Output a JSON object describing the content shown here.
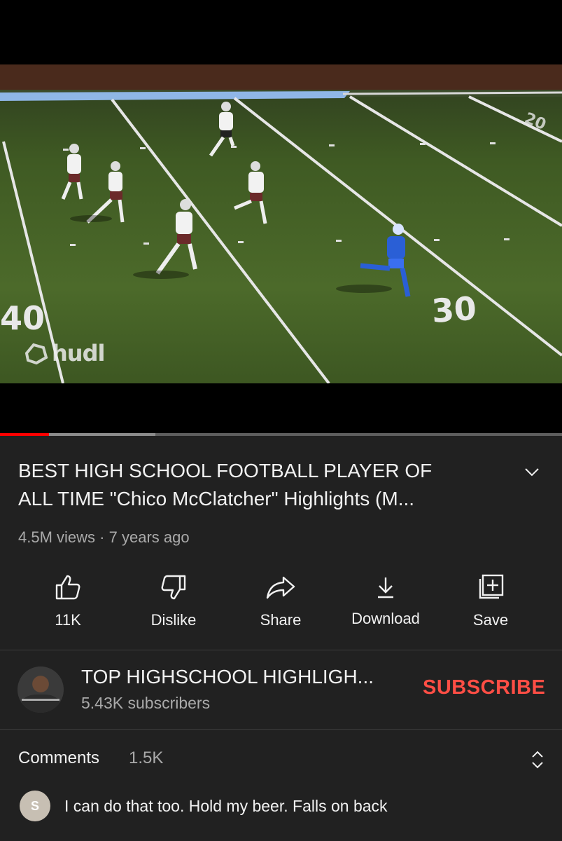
{
  "player": {
    "watermark": "hudl",
    "progress": {
      "played_fraction": 0.087,
      "buffered_fraction": 0.277
    },
    "field_numbers": [
      "40",
      "30",
      "20"
    ]
  },
  "video": {
    "title_line1": "BEST HIGH SCHOOL FOOTBALL PLAYER OF",
    "title_line2": "ALL TIME \"Chico McClatcher\" Highlights (M...",
    "views": "4.5M views",
    "separator": "·",
    "age": "7 years ago"
  },
  "actions": [
    {
      "label": "11K",
      "icon": "thumbs-up-icon"
    },
    {
      "label": "Dislike",
      "icon": "thumbs-down-icon"
    },
    {
      "label": "Share",
      "icon": "share-arrow-icon"
    },
    {
      "label": "Download",
      "icon": "download-icon"
    },
    {
      "label": "Save",
      "icon": "add-to-playlist-icon"
    }
  ],
  "channel": {
    "name": "TOP HIGHSCHOOL HIGHLIGH...",
    "subscribers": "5.43K subscribers",
    "subscribe_label": "SUBSCRIBE"
  },
  "comments": {
    "title": "Comments",
    "count": "1.5K",
    "first": {
      "avatar_letter": "S",
      "text": "I can do that too. Hold my beer. Falls on back"
    }
  },
  "colors": {
    "background": "#212121",
    "accent": "#ff0000",
    "subscribe": "#ff4e45",
    "secondary_text": "#aaaaaa"
  }
}
